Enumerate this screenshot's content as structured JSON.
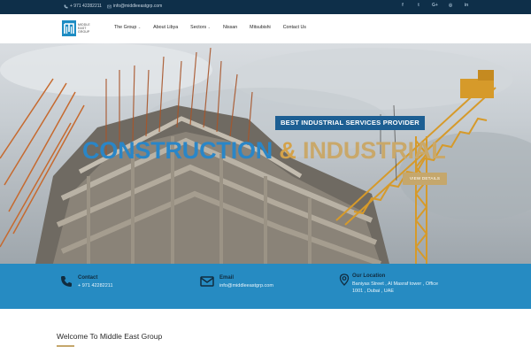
{
  "topbar": {
    "phone": "+ 971 42282211",
    "email": "info@middleeastgrp.com",
    "social": [
      {
        "icon": "facebook-icon",
        "glyph": "f"
      },
      {
        "icon": "twitter-icon",
        "glyph": "t"
      },
      {
        "icon": "google-plus-icon",
        "glyph": "G+"
      },
      {
        "icon": "instagram-icon",
        "glyph": "◎"
      },
      {
        "icon": "linkedin-icon",
        "glyph": "in"
      }
    ]
  },
  "logo": {
    "line1": "MIDDLE",
    "line2": "EAST",
    "line3": "GROUP"
  },
  "nav": {
    "items": [
      {
        "label": "The Group",
        "dropdown": true
      },
      {
        "label": "About Libya",
        "dropdown": false
      },
      {
        "label": "Sectors",
        "dropdown": true
      },
      {
        "label": "Nissan",
        "dropdown": false
      },
      {
        "label": "Mitsubishi",
        "dropdown": false
      },
      {
        "label": "Contact Us",
        "dropdown": false
      }
    ]
  },
  "hero": {
    "tagline": "BEST INDUSTRIAL SERVICES PROVIDER",
    "headline_part1": "CONSTRUCTION",
    "headline_amp": "&",
    "headline_part2": "INDUSTRIAL",
    "button": "VIEW DETAILS"
  },
  "info": {
    "contact_title": "Contact",
    "contact_value": "+ 971 42282211",
    "email_title": "Email",
    "email_value": "info@middleeastgrp.com",
    "location_title": "Our Location",
    "location_line1": "Baniyas Street , Al Masraf tower , Office",
    "location_line2": "1001 , Dubai , UAE"
  },
  "welcome": {
    "title": "Welcome To Middle East Group"
  },
  "colors": {
    "topbar_bg": "#0e2f49",
    "brand_blue": "#268bc2",
    "gold": "#c5a76c",
    "tag_bg": "#1d5f93"
  }
}
